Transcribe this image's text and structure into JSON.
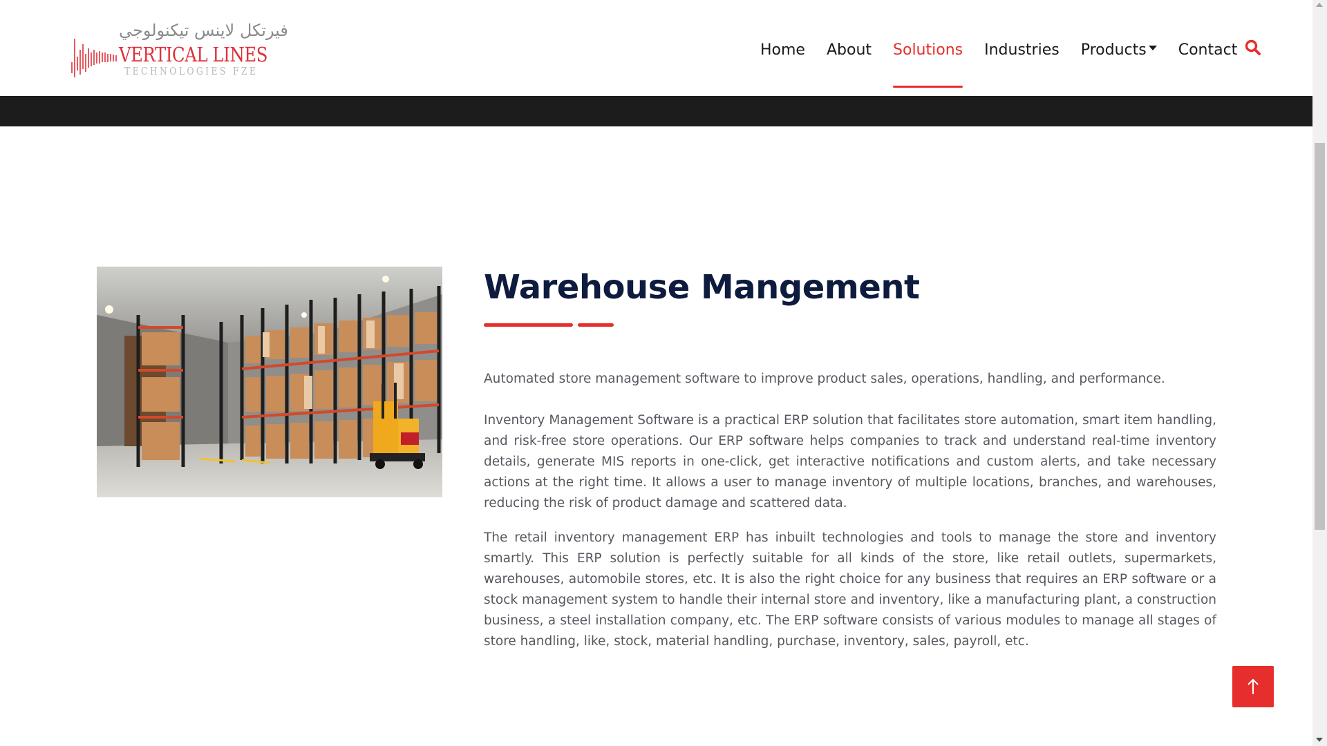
{
  "logo": {
    "arabic": "فيرتكل لاينس تيكنولوجي",
    "main": "VERTICAL LINES",
    "sub": "TECHNOLOGIES FZE"
  },
  "nav": {
    "items": [
      {
        "label": "Home"
      },
      {
        "label": "About"
      },
      {
        "label": "Solutions"
      },
      {
        "label": "Industries"
      },
      {
        "label": "Products"
      },
      {
        "label": "Contact"
      }
    ],
    "active": "Solutions",
    "search_icon": "search-icon"
  },
  "page": {
    "title": "Warehouse Mangement",
    "intro": "Automated store management software to improve product sales, operations, handling, and performance.",
    "paragraphs": [
      "Inventory Management Software is a practical ERP solution that facilitates store automation, smart item handling, and risk-free store operations. Our ERP software helps companies to track and understand real-time inventory details, generate MIS reports in one-click, get interactive notifications and custom alerts, and take necessary actions at the right time. It allows a user to manage inventory of multiple locations, branches, and warehouses, reducing the risk of product damage and scattered data.",
      "The retail inventory management ERP has inbuilt technologies and tools to manage the store and inventory smartly. This ERP solution is perfectly suitable for all kinds of the store, like retail outlets, supermarkets, warehouses, automobile stores, etc. It is also the right choice for any business that requires an ERP software or a stock management system to handle their internal store and inventory, like a manufacturing plant, a construction business, a steel installation company, etc. The ERP software consists of various modules to manage all stages of store handling, like, stock, material handling, purchase, inventory, sales, payroll, etc."
    ]
  },
  "colors": {
    "accent": "#e62e2d",
    "title": "#0d1b3e",
    "body_text": "#55595f",
    "dark_band": "#1c1c1c"
  },
  "back_to_top_icon": "arrow-up-icon"
}
